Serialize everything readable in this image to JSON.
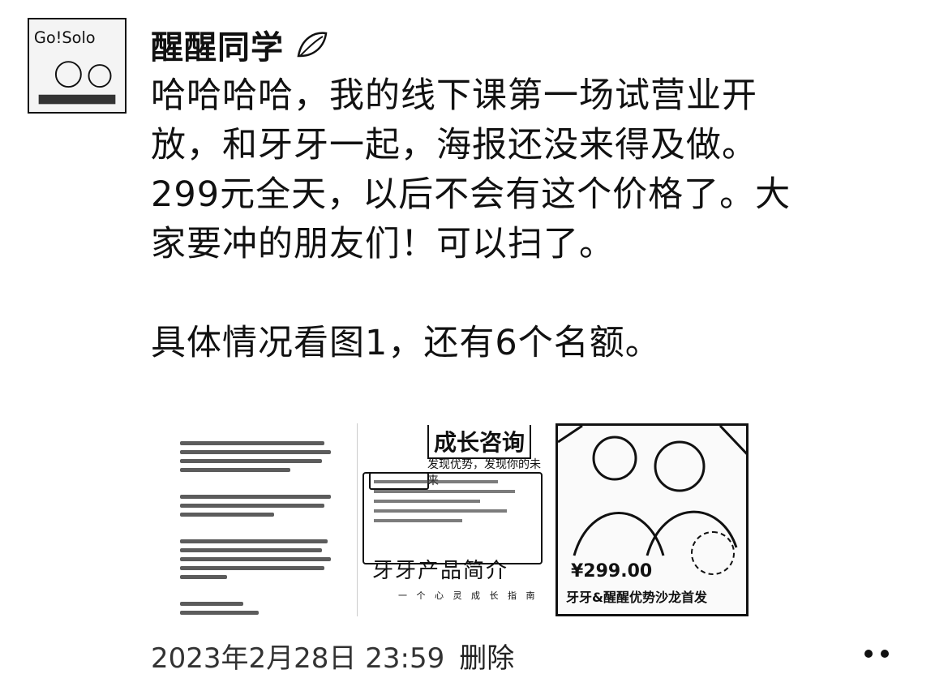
{
  "post": {
    "author": "醒醒同学",
    "text": "哈哈哈哈，我的线下课第一场试营业开\n放，和牙牙一起，海报还没来得及做。\n299元全天，以后不会有这个价格了。大\n家要冲的朋友们！可以扫了。\n\n具体情况看图1，还有6个名额。",
    "timestamp": "2023年2月28日 23:59",
    "delete_label": "删除"
  },
  "avatar": {
    "text": "Go!Solo"
  },
  "images": {
    "img2_title": "成长咨询",
    "img2_subtitle": "发现优势，发现你的未来",
    "img2_product": "牙牙产品简介",
    "img2_product_sub": "一 个 心 灵 成 长 指 南",
    "img3_price": "¥299.00",
    "img3_caption": "牙牙&醒醒优势沙龙首发"
  },
  "icons": {
    "author_badge": "leaf-icon",
    "more": "more-icon"
  }
}
